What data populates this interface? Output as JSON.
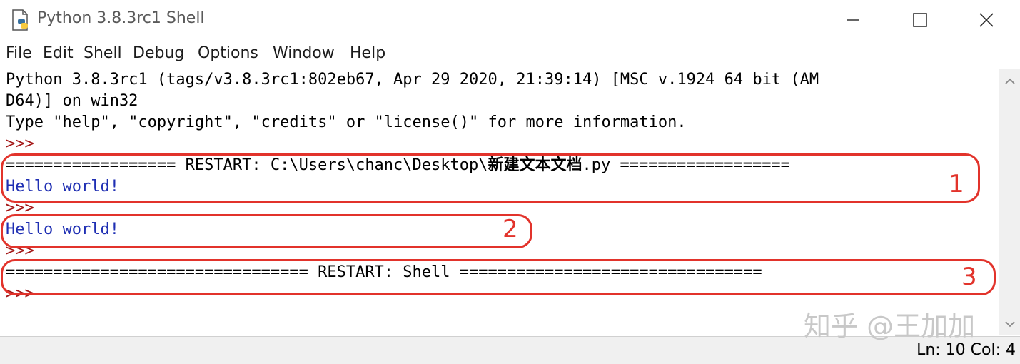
{
  "window": {
    "title": "Python 3.8.3rc1 Shell",
    "icon": "python-file-icon",
    "controls": {
      "minimize": "minimize-icon",
      "maximize": "maximize-icon",
      "close": "close-icon"
    }
  },
  "menu": [
    "File",
    "Edit",
    "Shell",
    "Debug",
    "Options",
    "Window",
    "Help"
  ],
  "shell": {
    "banner_1": "Python 3.8.3rc1 (tags/v3.8.3rc1:802eb67, Apr 29 2020, 21:39:14) [MSC v.1924 64 bit (AM",
    "banner_2": "D64)] on win32",
    "banner_3": "Type \"help\", \"copyright\", \"credits\" or \"license()\" for more information.",
    "prompt": ">>>",
    "restart_file_prefix": "================== RESTART: C:\\Users\\chanc\\Desktop\\",
    "restart_file_name_cjk": "新建文本文档",
    "restart_file_suffix": ".py ==================",
    "output_1": "Hello world!",
    "output_2": "Hello world!",
    "restart_shell": "================================ RESTART: Shell ================================"
  },
  "annotations": [
    "1",
    "2",
    "3"
  ],
  "status": {
    "position": "Ln: 10 Col: 4"
  },
  "watermark": "知乎 @王加加",
  "colors": {
    "prompt": "#a31515",
    "output": "#1f2fb3",
    "annotation": "#e2332b"
  }
}
